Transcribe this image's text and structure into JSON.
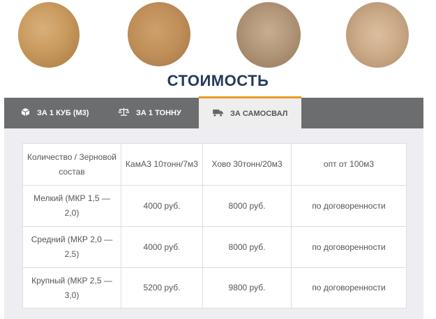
{
  "title": "СТОИМОСТЬ",
  "samples": [
    {
      "name": "sample-1"
    },
    {
      "name": "sample-2"
    },
    {
      "name": "sample-3"
    },
    {
      "name": "sample-4"
    }
  ],
  "tabs": [
    {
      "label": "ЗА 1 КУБ (М3)",
      "icon": "cube-icon"
    },
    {
      "label": "ЗА 1 ТОННУ",
      "icon": "scale-icon"
    },
    {
      "label": "ЗА САМОСВАЛ",
      "icon": "truck-icon",
      "active": true
    }
  ],
  "colors": {
    "accent": "#e89a1f",
    "title": "#253a5c",
    "tabbar": "#6c6d6f"
  },
  "table": {
    "header": [
      "Количество / Зерновой состав",
      "КамАЗ 10тонн/7м3",
      "Хово 30тонн/20м3",
      "опт от 100м3"
    ],
    "rows": [
      [
        "Мелкий (МКР 1,5 — 2,0)",
        "4000 руб.",
        "8000 руб.",
        "по договоренности"
      ],
      [
        "Средний (МКР 2,0 — 2,5)",
        "4000 руб.",
        "8000 руб.",
        "по договоренности"
      ],
      [
        "Крупный (МКР 2,5 — 3,0)",
        "5200 руб.",
        "9800 руб.",
        "по договоренности"
      ]
    ]
  }
}
